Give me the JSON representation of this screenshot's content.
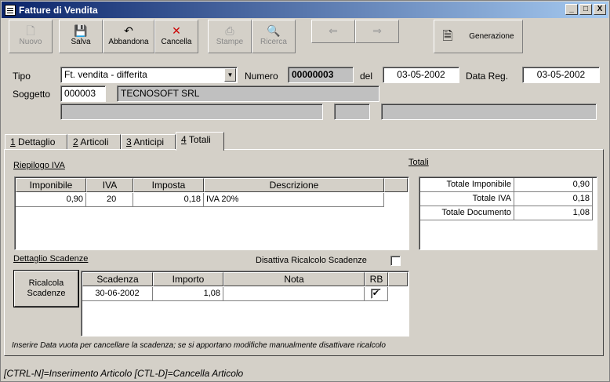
{
  "window": {
    "title": "Fatture di Vendita",
    "controls": [
      "_",
      "□",
      "X"
    ]
  },
  "toolbar": {
    "nuovo": "Nuovo",
    "salva": "Salva",
    "abbandona": "Abbandona",
    "cancella": "Cancella",
    "stampe": "Stampe",
    "ricerca": "Ricerca",
    "generazione": "Generazione"
  },
  "header": {
    "tipo_label": "Tipo",
    "tipo_value": "Ft. vendita - differita",
    "numero_label": "Numero",
    "numero_value": "00000003",
    "del_label": "del",
    "del_value": "03-05-2002",
    "datareg_label": "Data Reg.",
    "datareg_value": "03-05-2002",
    "soggetto_label": "Soggetto",
    "soggetto_code": "000003",
    "soggetto_name": "TECNOSOFT SRL"
  },
  "tabs": [
    {
      "num": "1",
      "label": "Dettaglio"
    },
    {
      "num": "2",
      "label": "Articoli"
    },
    {
      "num": "3",
      "label": "Anticipi"
    },
    {
      "num": "4",
      "label": "Totali"
    }
  ],
  "riepilogo": {
    "title": "Riepilogo IVA",
    "columns": [
      "Imponibile",
      "IVA",
      "Imposta",
      "Descrizione"
    ],
    "rows": [
      {
        "imponibile": "0,90",
        "iva": "20",
        "imposta": "0,18",
        "descrizione": "IVA 20%"
      }
    ]
  },
  "totali": {
    "title": "Totali",
    "rows": [
      {
        "label": "Totale Imponibile",
        "value": "0,90"
      },
      {
        "label": "Totale IVA",
        "value": "0,18"
      },
      {
        "label": "Totale Documento",
        "value": "1,08"
      }
    ]
  },
  "scadenze": {
    "title": "Dettaglio Scadenze",
    "disattiva_label": "Disattiva Ricalcolo Scadenze",
    "disattiva_checked": false,
    "ricalcola_line1": "Ricalcola",
    "ricalcola_line2": "Scadenze",
    "columns": [
      "Scadenza",
      "Importo",
      "Nota",
      "RB"
    ],
    "rows": [
      {
        "scadenza": "30-06-2002",
        "importo": "1,08",
        "nota": "",
        "rb": "✔"
      }
    ]
  },
  "note": "Inserire Data vuota per cancellare la scadenza; se si apportano modifiche manualmente disattivare ricalcolo",
  "status": "[CTRL-N]=Inserimento Articolo [CTL-D]=Cancella Articolo",
  "icons": {
    "nuovo": "document-icon",
    "salva": "floppy-icon",
    "abbandona": "undo-icon",
    "cancella": "close-icon",
    "stampe": "printer-icon",
    "ricerca": "search-icon",
    "prev": "arrow-left-icon",
    "next": "arrow-right-icon",
    "generazione": "generate-icon"
  }
}
